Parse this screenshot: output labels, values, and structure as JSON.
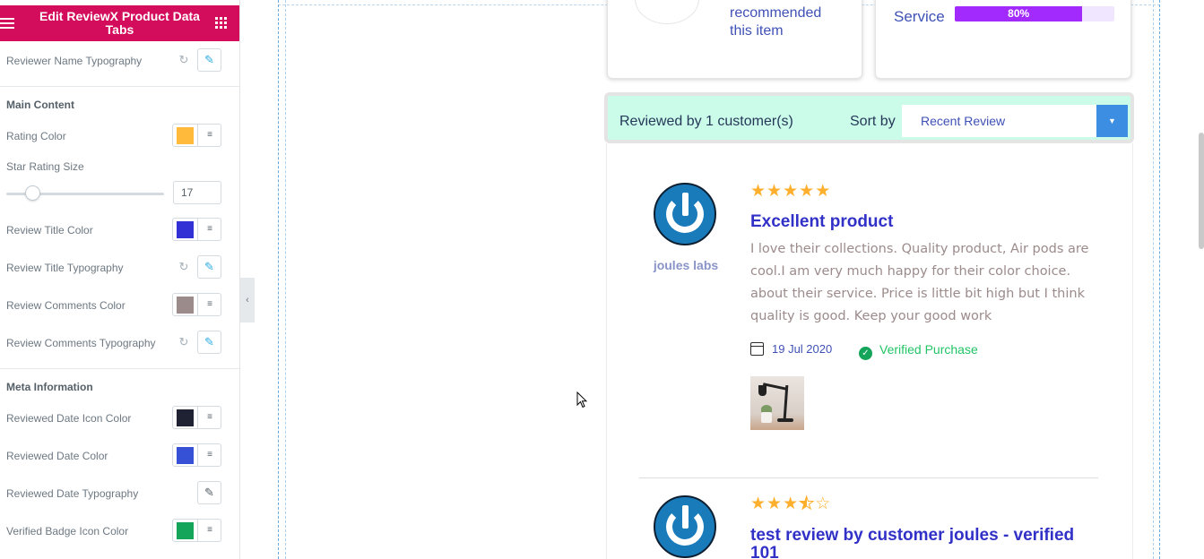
{
  "panel": {
    "title": "Edit ReviewX Product Data Tabs",
    "rows": [
      {
        "label": "Reviewer Name Typography"
      },
      {
        "label": "Rating Color",
        "color": "#ffba3b"
      },
      {
        "label": "Star Rating Size",
        "value": "17"
      },
      {
        "label": "Review Title Color",
        "color": "#3131d6"
      },
      {
        "label": "Review Title Typography"
      },
      {
        "label": "Review Comments Color",
        "color": "#9c8b8b"
      },
      {
        "label": "Review Comments Typography"
      },
      {
        "label": "Reviewed Date Icon Color",
        "color": "#1e2233"
      },
      {
        "label": "Reviewed Date Color",
        "color": "#3751d6"
      },
      {
        "label": "Reviewed Date Typography"
      },
      {
        "label": "Verified Badge Icon Color",
        "color": "#14a55a"
      }
    ],
    "sections": {
      "main_content": "Main Content",
      "meta_information": "Meta Information"
    },
    "slider_level": 0.17
  },
  "summary": {
    "recommended_text": "recommended this item",
    "service_label": "Service",
    "service_percent": "80%",
    "service_value": 0.8
  },
  "sort_bar": {
    "reviewed_count": "Reviewed by 1 customer(s)",
    "sort_label": "Sort by",
    "sort_value": "Recent Review"
  },
  "reviews": [
    {
      "reviewer": "joules labs",
      "rating": 5,
      "title": "Excellent product",
      "text": "I love their collections. Quality product, Air pods are cool.I am very much happy for their color choice. about their service. Price is little bit high but I think quality is good. Keep your good work",
      "date": "19 Jul 2020",
      "verified": "Verified Purchase"
    },
    {
      "rating": 3.5,
      "title": "test review by customer joules - verified 101"
    }
  ]
}
